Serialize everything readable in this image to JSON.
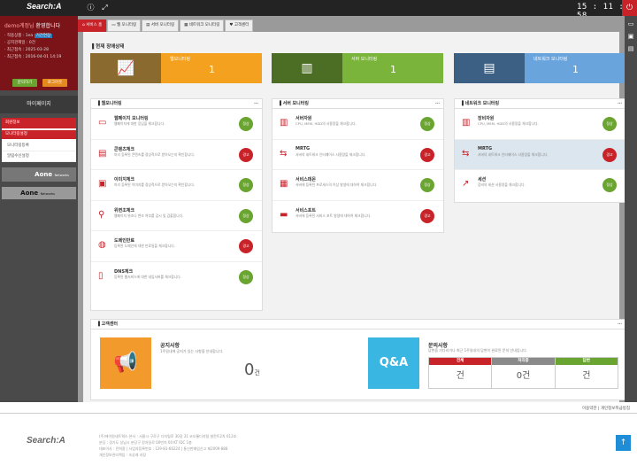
{
  "header": {
    "logo": "Search:A",
    "clock": "15 : 11 : 58",
    "info_icon": "info-icon",
    "fullscreen_icon": "expand-icon",
    "power_icon": "power-icon"
  },
  "user": {
    "name": "demo계정님",
    "welcome": " 환영합니다",
    "rows": [
      "· 적용상품 : 1ea",
      "· 공지관제일 : 0건",
      "· 최근접속 : 2025-03-28",
      "· 최근접속 : 2016-04-01 14:19"
    ],
    "badge": "기간연장",
    "btn_apply": "문의하기",
    "btn_logout": "로그아웃"
  },
  "sidebar": {
    "mypage": "마이페이지",
    "menu": [
      {
        "label": "회원정보",
        "active": true
      },
      {
        "label": "모니터링설정",
        "active": true
      },
      {
        "label": "모니터링등록",
        "active": false
      },
      {
        "label": "알림수신설정",
        "active": false
      }
    ],
    "banner1": "Aone",
    "banner1_sub": "Networks",
    "banner2": "Aone",
    "banner2_sub": "Networks"
  },
  "tabs": [
    "서비스 홈",
    "웹 모니터링",
    "서버 모니터링",
    "네트워크 모니터링",
    "고객센터"
  ],
  "overview": {
    "title": "현재 장애상태",
    "cards": [
      {
        "label": "웹모니터링",
        "count": "1",
        "color": "#f3a11f",
        "icon_bg": "#8a6a2e",
        "icon": "monitor-chart-icon"
      },
      {
        "label": "서버 모니터링",
        "count": "1",
        "color": "#7ab43a",
        "icon_bg": "#4c6d24",
        "icon": "server-icon"
      },
      {
        "label": "네트워크 모니터링",
        "count": "1",
        "color": "#6aa4dc",
        "icon_bg": "#3c5f84",
        "icon": "network-rack-icon"
      }
    ]
  },
  "web": {
    "title": "웹모니터링",
    "rows": [
      {
        "title": "웹페이지 모니터링",
        "desc": "웹페이지에 대한 응답을 체크합니다.",
        "status": "정상",
        "ok": true,
        "icon": "monitor-icon"
      },
      {
        "title": "콘텐츠체크",
        "desc": "미리 등록된 콘텐츠를 정상적으로 받아오는지 확인합니다.",
        "status": "경고",
        "ok": false,
        "icon": "content-check-icon"
      },
      {
        "title": "이미지체크",
        "desc": "미리 등록된 이미지를 정상적으로 받아오는지 확인합니다.",
        "status": "정상",
        "ok": true,
        "icon": "image-check-icon"
      },
      {
        "title": "위변조체크",
        "desc": "웹페이지 위조나 변조 여부를 감시 및 검출합니다.",
        "status": "정상",
        "ok": true,
        "icon": "magnifier-icon"
      },
      {
        "title": "도메인만료",
        "desc": "등록된 도메인에 대한 만료일을 체크합니다.",
        "status": "경고",
        "ok": false,
        "icon": "globe-icon"
      },
      {
        "title": "DNS체크",
        "desc": "등록된 웹서비스에 대한 네임서버를 체크합니다.",
        "status": "정상",
        "ok": true,
        "icon": "dns-icon"
      }
    ]
  },
  "server": {
    "title": "서버 모니터링",
    "rows": [
      {
        "title": "서버자원",
        "desc": "CPU, MEM, HDD의 사용량을 체크합니다.",
        "status": "정상",
        "ok": true,
        "icon": "server-resource-icon"
      },
      {
        "title": "MRTG",
        "desc": "서버의 네트워크 인터페이스 사용량을 체크합니다.",
        "status": "경고",
        "ok": false,
        "icon": "mrtg-arrows-icon"
      },
      {
        "title": "서비스데몬",
        "desc": "서버에 등록된 프로세스의 이상 발생에 대하여 체크합니다.",
        "status": "정상",
        "ok": true,
        "icon": "daemon-icon"
      },
      {
        "title": "서비스포트",
        "desc": "서버에 등록된 서비스 포트 발생에 대하여 체크합니다.",
        "status": "경고",
        "ok": false,
        "icon": "port-icon"
      }
    ]
  },
  "network": {
    "title": "네트워크 모니터링",
    "rows": [
      {
        "title": "장비자원",
        "desc": "CPU, MEM, HDD의 사용량을 체크합니다.",
        "status": "정상",
        "ok": true,
        "icon": "device-resource-icon"
      },
      {
        "title": "MRTG",
        "desc": "서버의 네트워크 인터페이스 사용량을 체크합니다.",
        "status": "경고",
        "ok": false,
        "icon": "mrtg-arrows-icon"
      },
      {
        "title": "세션",
        "desc": "장비의 세션 사용량을 체크합니다.",
        "status": "정상",
        "ok": true,
        "icon": "session-icon"
      }
    ]
  },
  "customer": {
    "title": "고객센터",
    "notice_title": "공지사항",
    "notice_desc": "1주일내에 공지가 있는 사항을 안내합니다.",
    "notice_count": "0",
    "notice_unit": "건",
    "qa_title": "문의사항",
    "qa_desc": "답변을 기다리거나 최근 1주일내의 답변이 완료된 문의 안내입니다.",
    "qa_icon_text": "Q&A",
    "qa_cols": [
      {
        "label": "전체",
        "value": "건",
        "color": "#c9232a"
      },
      {
        "label": "처리중",
        "value": "0건",
        "color": "#8a8a8a"
      },
      {
        "label": "답변",
        "value": "건",
        "color": "#6aa431"
      }
    ]
  },
  "footer": {
    "links": "이용약관  |  개인정보취급방침",
    "logo": "Search:A",
    "info": [
      "(주)에이원네트웍스 본사 : 서울시 구로구 디지털로 30길 31 코오롱디지털 빌란트2차 612호",
      "분당 : 경기도 성남시 분당구 정자일로 00번지 00 KT IDC 1층",
      "대표이사 : 전희종 | 사업자등록번호 : 129-81-66224 | 통신판매업신고 제2009-888",
      "개인정보관리책임 : 조상래 과장"
    ]
  }
}
